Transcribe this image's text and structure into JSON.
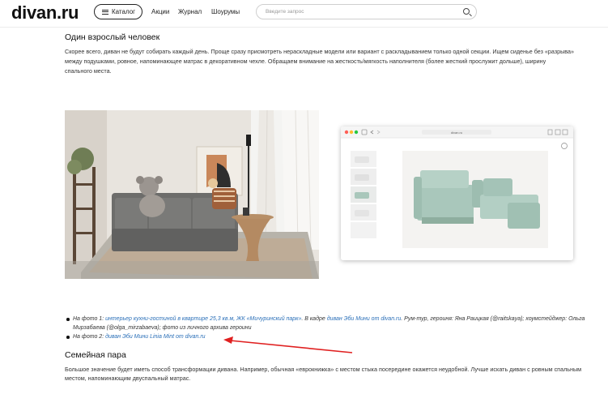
{
  "header": {
    "logo": "divan.ru",
    "catalog_label": "Каталог",
    "nav": [
      "Акции",
      "Журнал",
      "Шоурумы"
    ],
    "search_placeholder": "Введите запрос"
  },
  "section1": {
    "title": "Один взрослый человек",
    "text": "Скорее всего, диван не будут собирать каждый день. Проще сразу присмотреть нераскладные модели или вариант с раскладыванием только одной секции. Ищем сиденье без «разрыва» между подушками, ровное, напоминающее матрас в декоративном чехле. Обращаем внимание на жесткость/мягкость наполнителя (более жесткий прослужит дольше), ширину спального места."
  },
  "browser": {
    "url": "divan.ru"
  },
  "captions": {
    "c1_prefix": "На фото 1: ",
    "c1_link1": "интерьер кухни-гостиной в квартире 25,3 кв.м, ЖК «Мичуринский парк»",
    "c1_mid": ". В кадре ",
    "c1_link2": "диван Эби Мини от divan.ru",
    "c1_suffix": ". Рум-тур, героиня: Яна Раицкая (@raitskaya); хоумстейджер: Ольга Мирзабаева (@olga_mirzabaeva); фото из личного архива героини",
    "c2_prefix": "На фото 2: ",
    "c2_link": "диван Эби Мини Linia Mint от divan.ru"
  },
  "section2": {
    "title": "Семейная пара",
    "text": "Большое значение будет иметь способ трансформации дивана. Например, обычная «еврокнижка» с местом стыка посередине окажется неудобной. Лучше искать диван с ровным спальным местом, напоминающим двуспальный матрас."
  },
  "colors": {
    "link": "#2a6fb8",
    "arrow": "#e02020",
    "sofa_photo2": "#a9c7bb"
  }
}
